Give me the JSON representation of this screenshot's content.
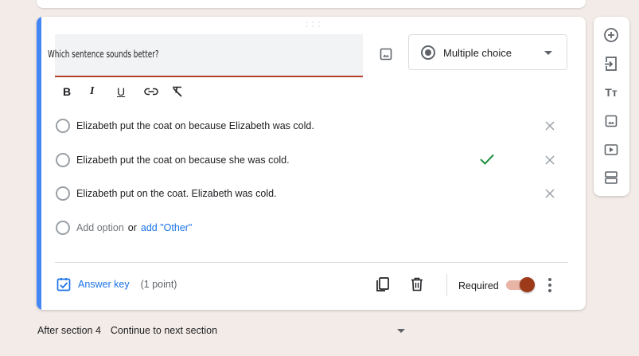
{
  "question": {
    "text": "Which sentence sounds better?",
    "type_label": "Multiple choice",
    "type_icon": "radio-button-icon"
  },
  "formatting": {
    "bold": "B",
    "italic": "I",
    "underline": "U",
    "icons": [
      "link-icon",
      "clear-formatting-icon"
    ]
  },
  "options": [
    {
      "text": "Elizabeth put the coat on because Elizabeth was cold.",
      "correct": false
    },
    {
      "text": "Elizabeth put the coat on because she was cold.",
      "correct": true
    },
    {
      "text": "Elizabeth put on the coat. Elizabeth was cold.",
      "correct": false
    }
  ],
  "add_option": {
    "label": "Add option",
    "or": "or",
    "other_link": "add \"Other\""
  },
  "footer": {
    "answer_key": "Answer key",
    "points": "(1 point)",
    "required_label": "Required",
    "required_on": true
  },
  "side_toolbar": {
    "items": [
      "add-question-icon",
      "import-questions-icon",
      "add-title-icon",
      "add-image-icon",
      "add-video-icon",
      "add-section-icon"
    ],
    "title_glyph": "Tт"
  },
  "after_section": {
    "label": "After section 4",
    "value": "Continue to next section"
  },
  "colors": {
    "accent": "#4285f4",
    "link": "#1a73e8",
    "underline": "#b4402a",
    "toggle_knob": "#9c3a1a",
    "check": "#1e8e3e",
    "background": "#f3ebe7"
  }
}
